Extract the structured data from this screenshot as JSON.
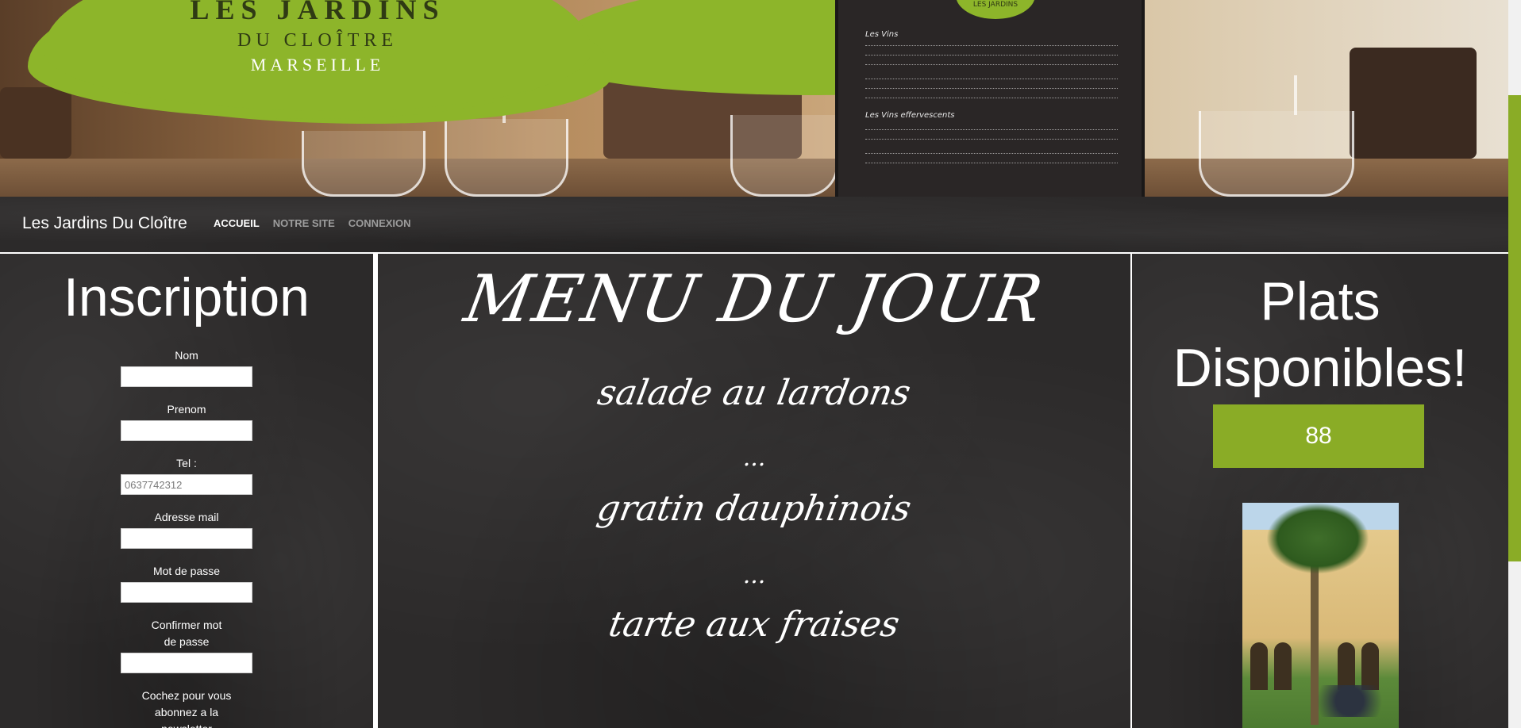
{
  "hero": {
    "logo": {
      "line1": "LES JARDINS",
      "line2": "DU CLOÎTRE",
      "line3": "MARSEILLE"
    },
    "chalkboard_badge": "LES JARDINS",
    "chalkboard_sections": [
      "Les Vins",
      "Les Vins effervescents"
    ]
  },
  "navbar": {
    "brand": "Les Jardins Du Cloître",
    "links": [
      {
        "label": "ACCUEIL",
        "active": true
      },
      {
        "label": "NOTRE SITE",
        "active": false
      },
      {
        "label": "CONNEXION",
        "active": false
      }
    ]
  },
  "inscription": {
    "title": "Inscription",
    "fields": [
      {
        "label": "Nom",
        "value": "",
        "placeholder": ""
      },
      {
        "label": "Prenom",
        "value": "",
        "placeholder": ""
      },
      {
        "label": "Tel :",
        "value": "",
        "placeholder": "0637742312"
      },
      {
        "label": "Adresse mail",
        "value": "",
        "placeholder": ""
      },
      {
        "label": "Mot de passe",
        "value": "",
        "placeholder": ""
      },
      {
        "label": "Confirmer mot de passe",
        "value": "",
        "placeholder": ""
      }
    ],
    "newsletter_label": "Cochez pour vous abonnez a la newsletter"
  },
  "menu_du_jour": {
    "title": "MENU DU JOUR",
    "dishes": [
      "salade au lardons",
      "gratin dauphinois",
      "tarte aux fraises"
    ],
    "separator": "..."
  },
  "plats": {
    "title": "Plats Disponibles!",
    "count": "88"
  },
  "colors": {
    "accent": "#8aac26",
    "chalkboard": "#2c2a2a",
    "nav_inactive": "#9d9d9d"
  }
}
